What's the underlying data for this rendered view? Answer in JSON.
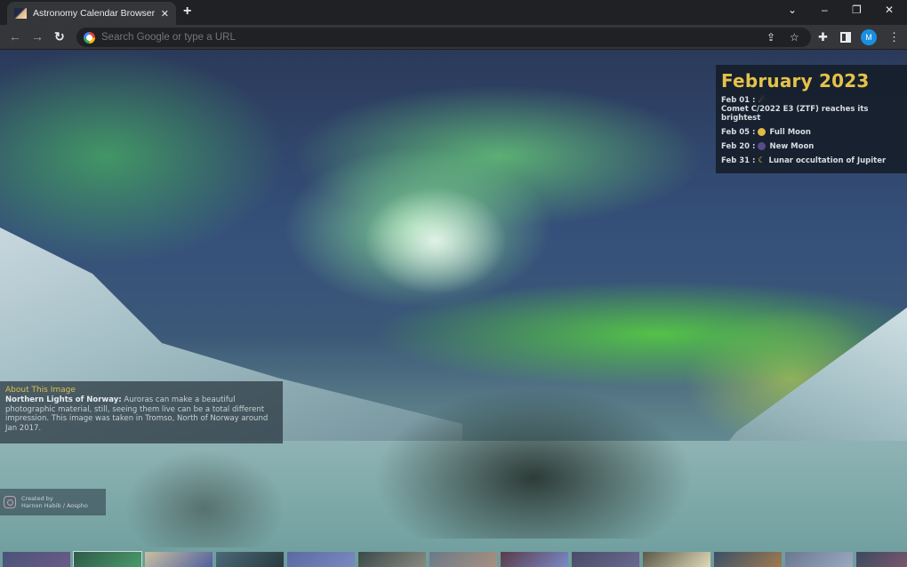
{
  "browser": {
    "tab": {
      "title": "Astronomy Calendar Browser Ext",
      "favicon": "astronomy-favicon",
      "close_icon": "✕"
    },
    "new_tab_icon": "+",
    "window_controls": {
      "tab_search": "⌄",
      "minimize": "–",
      "restore": "❐",
      "close": "✕"
    },
    "nav": {
      "back": "←",
      "forward": "→",
      "reload": "↻"
    },
    "omnibox": {
      "placeholder": "Search Google or type a URL",
      "value": ""
    },
    "toolbar_icons": {
      "share": "⇪",
      "bookmark": "☆",
      "extensions": "✚",
      "menu": "⋮"
    },
    "profile_initial": "M"
  },
  "calendar": {
    "title": "February 2023",
    "events": [
      {
        "date": "Feb 01 :",
        "icon": "comet-icon",
        "glyph": "☄",
        "text": "Comet C/2022 E3 (ZTF) reaches its brightest"
      },
      {
        "date": "Feb 05 :",
        "icon": "full-moon-icon",
        "glyph": "",
        "text": "Full Moon"
      },
      {
        "date": "Feb 20 :",
        "icon": "new-moon-icon",
        "glyph": "",
        "text": "New Moon"
      },
      {
        "date": "Feb 31 :",
        "icon": "occultation-icon",
        "glyph": "☾",
        "text": "Lunar occultation of Jupiter"
      }
    ]
  },
  "about": {
    "heading": "About This Image",
    "title_bold": "Northern Lights of Norway:",
    "body": " Auroras can make a beautiful photographic material, still, seeing them live can be a total different impression. This image was taken in Tromso, North of Norway around Jan 2017."
  },
  "credit": {
    "line1": "Created by",
    "line2": "Harnon Habib / Aospho"
  },
  "thumbnails": [
    {
      "name": "thumb-nebula-purple",
      "colors": [
        "#4a5478",
        "#6a5a88"
      ]
    },
    {
      "name": "thumb-aurora-green",
      "colors": [
        "#2f5a4a",
        "#4a9a6a"
      ],
      "active": true
    },
    {
      "name": "thumb-planet-map",
      "colors": [
        "#c8c0a0",
        "#5060a0"
      ]
    },
    {
      "name": "thumb-dark-silhouette",
      "colors": [
        "#4a6a78",
        "#2a3a40"
      ]
    },
    {
      "name": "thumb-galaxy-blue",
      "colors": [
        "#5a6aa0",
        "#7a8ac0"
      ]
    },
    {
      "name": "thumb-dark-moon",
      "colors": [
        "#3a4a4a",
        "#8a8a80"
      ]
    },
    {
      "name": "thumb-milky-way-light",
      "colors": [
        "#6a7a88",
        "#a89080"
      ]
    },
    {
      "name": "thumb-red-nebula",
      "colors": [
        "#5a3a48",
        "#7a8ac8"
      ]
    },
    {
      "name": "thumb-starfield",
      "colors": [
        "#4a4a68",
        "#6a6a90"
      ]
    },
    {
      "name": "thumb-clouds-sunset",
      "colors": [
        "#5a5a48",
        "#e0d8b8"
      ]
    },
    {
      "name": "thumb-galaxy-colorful",
      "colors": [
        "#3a5068",
        "#a07a50"
      ]
    },
    {
      "name": "thumb-milky-way-blue",
      "colors": [
        "#6a7890",
        "#9aa8c0"
      ]
    },
    {
      "name": "thumb-deep-space",
      "colors": [
        "#3a4a60",
        "#8a5a70"
      ]
    }
  ],
  "colors": {
    "accent_gold": "#e5c24a",
    "profile_blue": "#1a8fe0"
  }
}
